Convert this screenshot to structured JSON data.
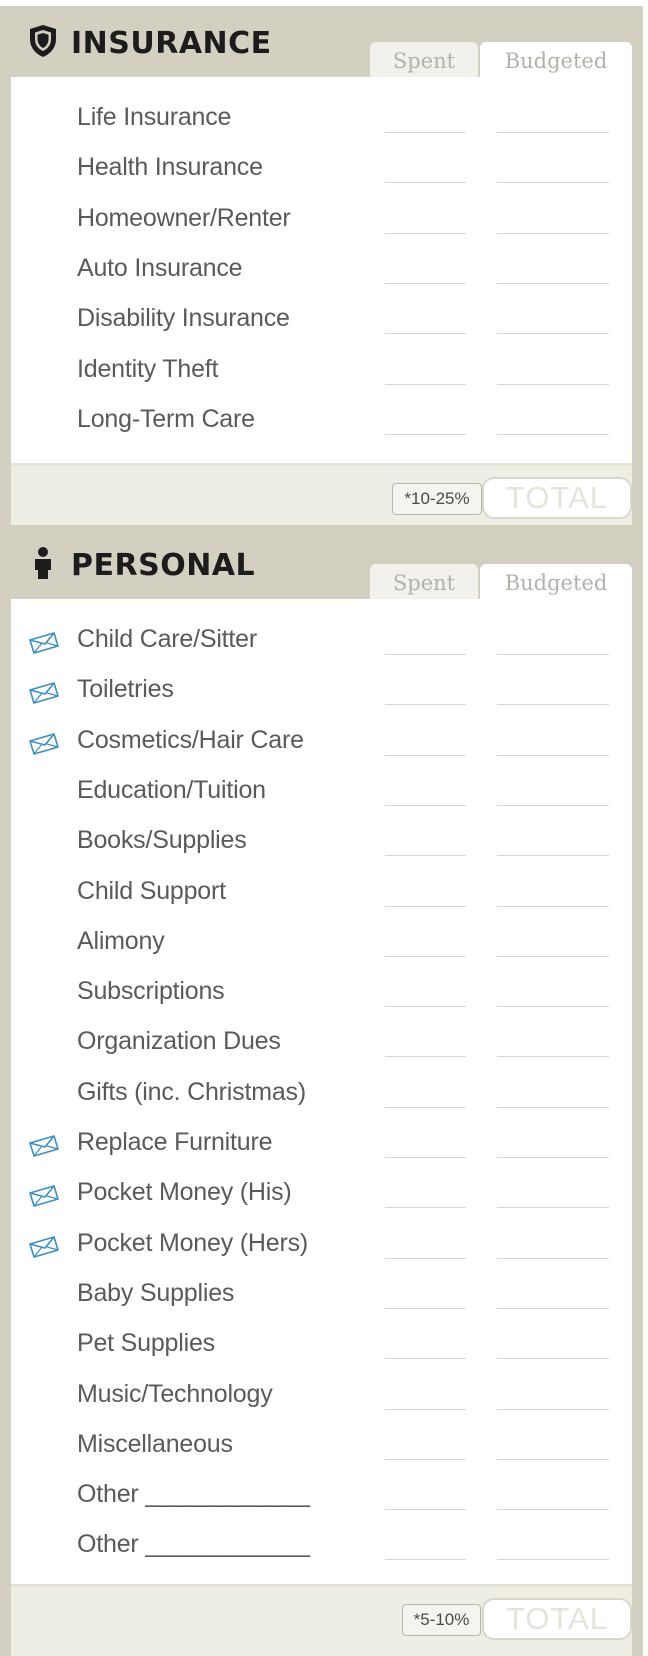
{
  "insurance": {
    "title": "INSURANCE",
    "icon": "shield-icon",
    "spent_label": "Spent",
    "budgeted_label": "Budgeted",
    "items": [
      {
        "label": "Life Insurance",
        "envelope": false
      },
      {
        "label": "Health Insurance",
        "envelope": false
      },
      {
        "label": "Homeowner/Renter",
        "envelope": false
      },
      {
        "label": "Auto Insurance",
        "envelope": false
      },
      {
        "label": "Disability Insurance",
        "envelope": false
      },
      {
        "label": "Identity Theft",
        "envelope": false
      },
      {
        "label": "Long-Term Care",
        "envelope": false
      }
    ],
    "percent": "*10-25%",
    "total_label": "TOTAL"
  },
  "personal": {
    "title": "PERSONAL",
    "icon": "person-icon",
    "spent_label": "Spent",
    "budgeted_label": "Budgeted",
    "items": [
      {
        "label": "Child Care/Sitter",
        "envelope": true
      },
      {
        "label": "Toiletries",
        "envelope": true
      },
      {
        "label": "Cosmetics/Hair Care",
        "envelope": true
      },
      {
        "label": "Education/Tuition",
        "envelope": false
      },
      {
        "label": "Books/Supplies",
        "envelope": false
      },
      {
        "label": "Child Support",
        "envelope": false
      },
      {
        "label": "Alimony",
        "envelope": false
      },
      {
        "label": "Subscriptions",
        "envelope": false
      },
      {
        "label": "Organization Dues",
        "envelope": false
      },
      {
        "label": "Gifts (inc. Christmas)",
        "envelope": false
      },
      {
        "label": "Replace Furniture",
        "envelope": true
      },
      {
        "label": "Pocket Money (His)",
        "envelope": true
      },
      {
        "label": "Pocket Money (Hers)",
        "envelope": true
      },
      {
        "label": "Baby Supplies",
        "envelope": false
      },
      {
        "label": "Pet Supplies",
        "envelope": false
      },
      {
        "label": "Music/Technology",
        "envelope": false
      },
      {
        "label": "Miscellaneous",
        "envelope": false
      },
      {
        "label": "Other ____________",
        "envelope": false
      },
      {
        "label": "Other ____________",
        "envelope": false
      }
    ],
    "percent": "*5-10%",
    "total_label": "TOTAL"
  },
  "colors": {
    "frame": "#d3d0c2",
    "footer": "#efeee5",
    "envelope_icon": "#3a8fc4"
  }
}
